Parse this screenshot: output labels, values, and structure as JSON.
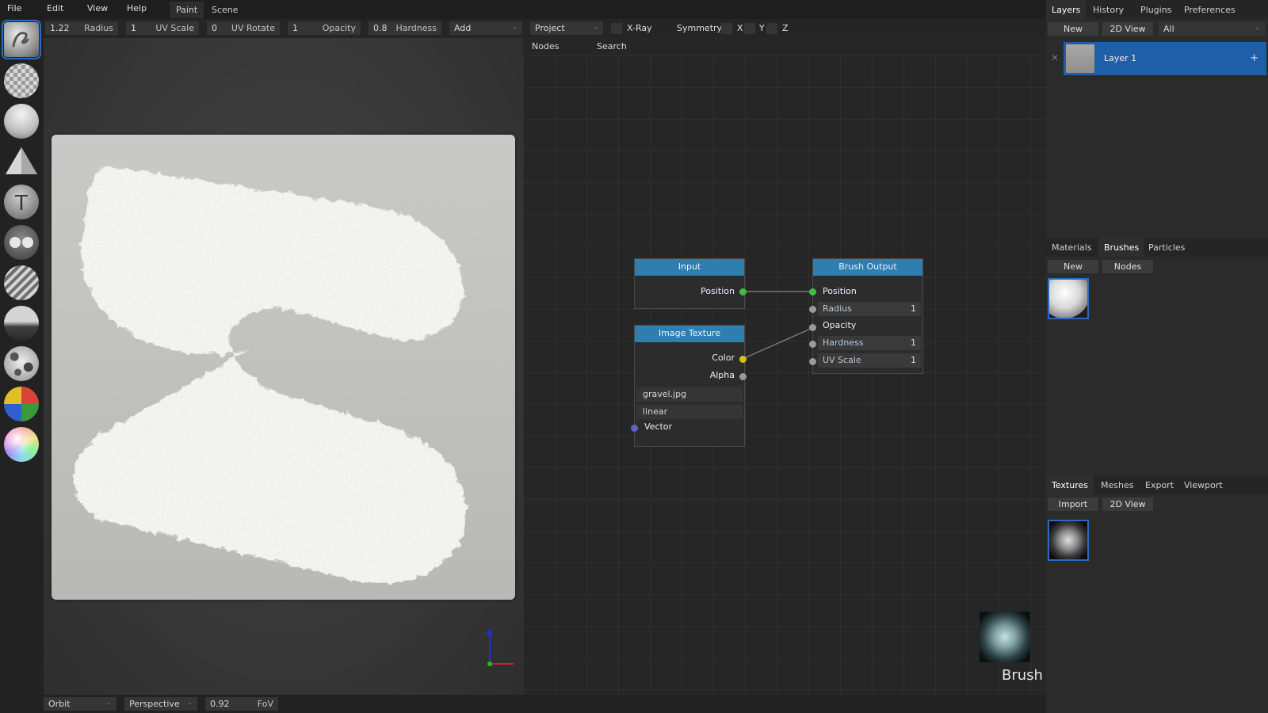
{
  "menu": {
    "file": "File",
    "edit": "Edit",
    "view": "View",
    "help": "Help"
  },
  "workspaces": {
    "paint": "Paint",
    "scene": "Scene"
  },
  "toolbar": {
    "radius": {
      "value": "1.22",
      "label": "Radius"
    },
    "uv_scale": {
      "value": "1",
      "label": "UV Scale"
    },
    "uv_rotate": {
      "value": "0",
      "label": "UV Rotate"
    },
    "opacity": {
      "value": "1",
      "label": "Opacity"
    },
    "hardness": {
      "value": "0.8",
      "label": "Hardness"
    },
    "blending": "Add",
    "projection": "Project",
    "xray": "X-Ray",
    "symmetry": "Symmetry",
    "sym_x": "X",
    "sym_y": "Y",
    "sym_z": "Z"
  },
  "tools": [
    "brush-tool-icon",
    "eraser-tool-icon",
    "fill-tool-icon",
    "decal-tool-icon",
    "text-tool-icon",
    "clone-tool-icon",
    "blur-tool-icon",
    "smudge-tool-icon",
    "particle-tool-icon",
    "colorid-tool-icon",
    "picker-tool-icon"
  ],
  "node_editor": {
    "tabs": {
      "nodes": "Nodes",
      "search": "Search"
    },
    "input_node": {
      "title": "Input",
      "position": "Position"
    },
    "image_node": {
      "title": "Image Texture",
      "color": "Color",
      "alpha": "Alpha",
      "file": "gravel.jpg",
      "interp": "linear",
      "vector": "Vector"
    },
    "output_node": {
      "title": "Brush Output",
      "position": "Position",
      "radius": "Radius",
      "radius_val": "1",
      "opacity": "Opacity",
      "hardness": "Hardness",
      "hardness_val": "1",
      "uv_scale": "UV Scale",
      "uv_scale_val": "1"
    },
    "preview_label": "Brush"
  },
  "bottombar": {
    "nav": "Orbit",
    "camera": "Perspective",
    "fov_value": "0.92",
    "fov_label": "FoV"
  },
  "layers_panel": {
    "tabs": {
      "layers": "Layers",
      "history": "History",
      "plugins": "Plugins",
      "preferences": "Preferences"
    },
    "new": "New",
    "view2d": "2D View",
    "filter": "All",
    "layer_name": "Layer 1"
  },
  "materials_panel": {
    "tabs": {
      "materials": "Materials",
      "brushes": "Brushes",
      "particles": "Particles"
    },
    "new": "New",
    "nodes": "Nodes"
  },
  "textures_panel": {
    "tabs": {
      "textures": "Textures",
      "meshes": "Meshes",
      "export": "Export",
      "viewport": "Viewport"
    },
    "import": "Import",
    "view2d": "2D View"
  },
  "colors": {
    "accent": "#2a6bc0",
    "node_header": "#2f7eb0",
    "socket_green": "#3fbf3f",
    "socket_yellow": "#d4c21a",
    "socket_gray": "#9a9a9a",
    "socket_blue": "#6363c7"
  }
}
